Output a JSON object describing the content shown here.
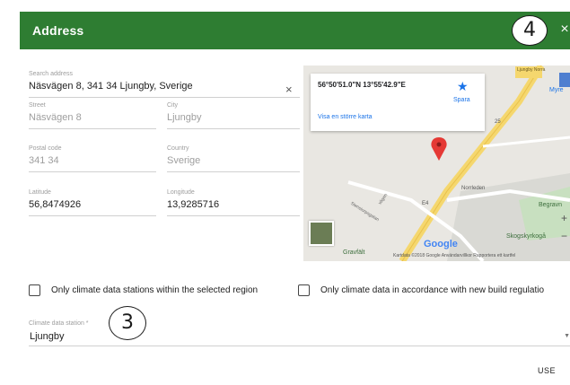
{
  "dialog": {
    "title": "Address",
    "close_glyph": "×",
    "accent_color": "#2e7d32"
  },
  "annotations": {
    "marker_close": "4",
    "marker_station": "3"
  },
  "form": {
    "search": {
      "label": "Search address",
      "value": "Näsvägen 8, 341 34 Ljungby, Sverige",
      "clear_glyph": "×"
    },
    "street": {
      "label": "Street",
      "value": "Näsvägen 8"
    },
    "city": {
      "label": "City",
      "value": "Ljungby"
    },
    "postal": {
      "label": "Postal code",
      "value": "341 34"
    },
    "country": {
      "label": "Country",
      "value": "Sverige"
    },
    "latitude": {
      "label": "Latitude",
      "value": "56,8474926"
    },
    "longitude": {
      "label": "Longitude",
      "value": "13,9285716"
    }
  },
  "map": {
    "coords": "56°50'51.0\"N 13°55'42.9\"E",
    "save_label": "Spara",
    "larger_map_link": "Visa en större karta",
    "labels": {
      "ljungby_norra": "Ljungby Norra",
      "myre": "Myre",
      "norrleden": "Norrleden",
      "begravn": "Begravn",
      "skogskyrkogard": "Skogskyrkogå",
      "grafvalt": "Gravfält",
      "route_25": "25",
      "route_e4": "E4",
      "stenstrgatan": "Stenstorpsgatan",
      "vagen": "vägen"
    },
    "google_logo": "Google",
    "attribution": "Kartdata ©2018 Google   Användarvillkor   Rapportera ett kartfel",
    "zoom_in": "+",
    "zoom_out": "−"
  },
  "filters": {
    "region_only": "Only climate data stations within the selected region",
    "new_build": "Only climate data in accordance with new build regulatio"
  },
  "station": {
    "label": "Climate data station *",
    "value": "Ljungby",
    "arrow": "▼"
  },
  "actions": {
    "use_label": "USE"
  }
}
